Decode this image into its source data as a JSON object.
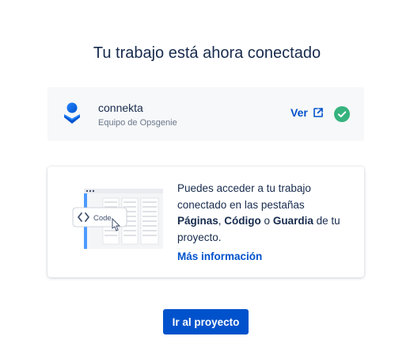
{
  "header": {
    "title": "Tu trabajo está ahora conectado"
  },
  "team": {
    "name": "connekta",
    "subtitle": "Equipo de Opsgenie",
    "logo_icon": "opsgenie-logo-icon",
    "view_label": "Ver",
    "view_icon": "external-link-icon",
    "status_icon": "check-circle-icon",
    "status_color": "#36b37e"
  },
  "info": {
    "illustration_label": "Code",
    "text_part1": "Puedes acceder a tu trabajo conectado en las pestañas ",
    "tab_pages": "Páginas",
    "separator": ", ",
    "tab_code": "Código",
    "connector": " o ",
    "tab_guard": "Guardia",
    "text_part2": " de tu proyecto.",
    "more_link": "Más información"
  },
  "actions": {
    "primary_label": "Ir al proyecto"
  },
  "colors": {
    "accent": "#0052cc",
    "text": "#172b4d",
    "muted": "#6b778c",
    "card_bg": "#f7f8f9",
    "success": "#36b37e"
  }
}
